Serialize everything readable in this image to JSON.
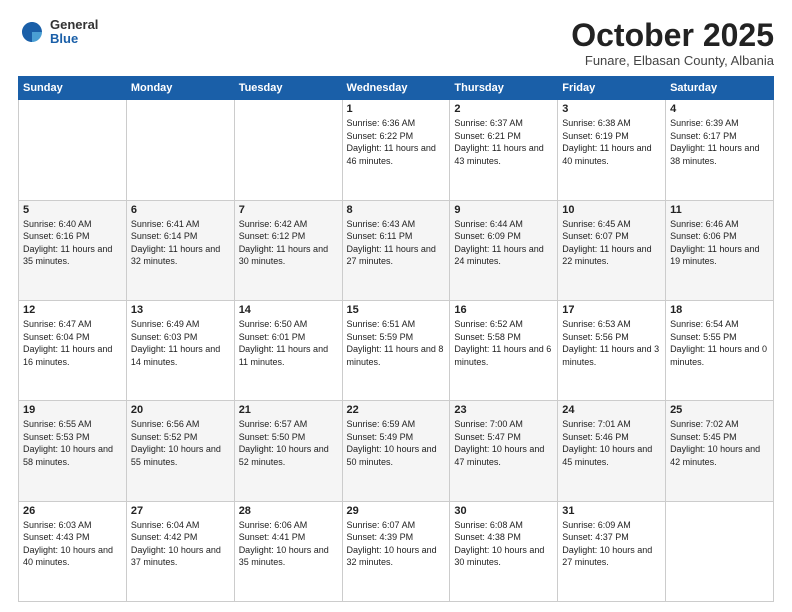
{
  "header": {
    "logo_general": "General",
    "logo_blue": "Blue",
    "month": "October 2025",
    "location": "Funare, Elbasan County, Albania"
  },
  "weekdays": [
    "Sunday",
    "Monday",
    "Tuesday",
    "Wednesday",
    "Thursday",
    "Friday",
    "Saturday"
  ],
  "weeks": [
    [
      {
        "day": "",
        "text": ""
      },
      {
        "day": "",
        "text": ""
      },
      {
        "day": "",
        "text": ""
      },
      {
        "day": "1",
        "text": "Sunrise: 6:36 AM\nSunset: 6:22 PM\nDaylight: 11 hours\nand 46 minutes."
      },
      {
        "day": "2",
        "text": "Sunrise: 6:37 AM\nSunset: 6:21 PM\nDaylight: 11 hours\nand 43 minutes."
      },
      {
        "day": "3",
        "text": "Sunrise: 6:38 AM\nSunset: 6:19 PM\nDaylight: 11 hours\nand 40 minutes."
      },
      {
        "day": "4",
        "text": "Sunrise: 6:39 AM\nSunset: 6:17 PM\nDaylight: 11 hours\nand 38 minutes."
      }
    ],
    [
      {
        "day": "5",
        "text": "Sunrise: 6:40 AM\nSunset: 6:16 PM\nDaylight: 11 hours\nand 35 minutes."
      },
      {
        "day": "6",
        "text": "Sunrise: 6:41 AM\nSunset: 6:14 PM\nDaylight: 11 hours\nand 32 minutes."
      },
      {
        "day": "7",
        "text": "Sunrise: 6:42 AM\nSunset: 6:12 PM\nDaylight: 11 hours\nand 30 minutes."
      },
      {
        "day": "8",
        "text": "Sunrise: 6:43 AM\nSunset: 6:11 PM\nDaylight: 11 hours\nand 27 minutes."
      },
      {
        "day": "9",
        "text": "Sunrise: 6:44 AM\nSunset: 6:09 PM\nDaylight: 11 hours\nand 24 minutes."
      },
      {
        "day": "10",
        "text": "Sunrise: 6:45 AM\nSunset: 6:07 PM\nDaylight: 11 hours\nand 22 minutes."
      },
      {
        "day": "11",
        "text": "Sunrise: 6:46 AM\nSunset: 6:06 PM\nDaylight: 11 hours\nand 19 minutes."
      }
    ],
    [
      {
        "day": "12",
        "text": "Sunrise: 6:47 AM\nSunset: 6:04 PM\nDaylight: 11 hours\nand 16 minutes."
      },
      {
        "day": "13",
        "text": "Sunrise: 6:49 AM\nSunset: 6:03 PM\nDaylight: 11 hours\nand 14 minutes."
      },
      {
        "day": "14",
        "text": "Sunrise: 6:50 AM\nSunset: 6:01 PM\nDaylight: 11 hours\nand 11 minutes."
      },
      {
        "day": "15",
        "text": "Sunrise: 6:51 AM\nSunset: 5:59 PM\nDaylight: 11 hours\nand 8 minutes."
      },
      {
        "day": "16",
        "text": "Sunrise: 6:52 AM\nSunset: 5:58 PM\nDaylight: 11 hours\nand 6 minutes."
      },
      {
        "day": "17",
        "text": "Sunrise: 6:53 AM\nSunset: 5:56 PM\nDaylight: 11 hours\nand 3 minutes."
      },
      {
        "day": "18",
        "text": "Sunrise: 6:54 AM\nSunset: 5:55 PM\nDaylight: 11 hours\nand 0 minutes."
      }
    ],
    [
      {
        "day": "19",
        "text": "Sunrise: 6:55 AM\nSunset: 5:53 PM\nDaylight: 10 hours\nand 58 minutes."
      },
      {
        "day": "20",
        "text": "Sunrise: 6:56 AM\nSunset: 5:52 PM\nDaylight: 10 hours\nand 55 minutes."
      },
      {
        "day": "21",
        "text": "Sunrise: 6:57 AM\nSunset: 5:50 PM\nDaylight: 10 hours\nand 52 minutes."
      },
      {
        "day": "22",
        "text": "Sunrise: 6:59 AM\nSunset: 5:49 PM\nDaylight: 10 hours\nand 50 minutes."
      },
      {
        "day": "23",
        "text": "Sunrise: 7:00 AM\nSunset: 5:47 PM\nDaylight: 10 hours\nand 47 minutes."
      },
      {
        "day": "24",
        "text": "Sunrise: 7:01 AM\nSunset: 5:46 PM\nDaylight: 10 hours\nand 45 minutes."
      },
      {
        "day": "25",
        "text": "Sunrise: 7:02 AM\nSunset: 5:45 PM\nDaylight: 10 hours\nand 42 minutes."
      }
    ],
    [
      {
        "day": "26",
        "text": "Sunrise: 6:03 AM\nSunset: 4:43 PM\nDaylight: 10 hours\nand 40 minutes."
      },
      {
        "day": "27",
        "text": "Sunrise: 6:04 AM\nSunset: 4:42 PM\nDaylight: 10 hours\nand 37 minutes."
      },
      {
        "day": "28",
        "text": "Sunrise: 6:06 AM\nSunset: 4:41 PM\nDaylight: 10 hours\nand 35 minutes."
      },
      {
        "day": "29",
        "text": "Sunrise: 6:07 AM\nSunset: 4:39 PM\nDaylight: 10 hours\nand 32 minutes."
      },
      {
        "day": "30",
        "text": "Sunrise: 6:08 AM\nSunset: 4:38 PM\nDaylight: 10 hours\nand 30 minutes."
      },
      {
        "day": "31",
        "text": "Sunrise: 6:09 AM\nSunset: 4:37 PM\nDaylight: 10 hours\nand 27 minutes."
      },
      {
        "day": "",
        "text": ""
      }
    ]
  ]
}
